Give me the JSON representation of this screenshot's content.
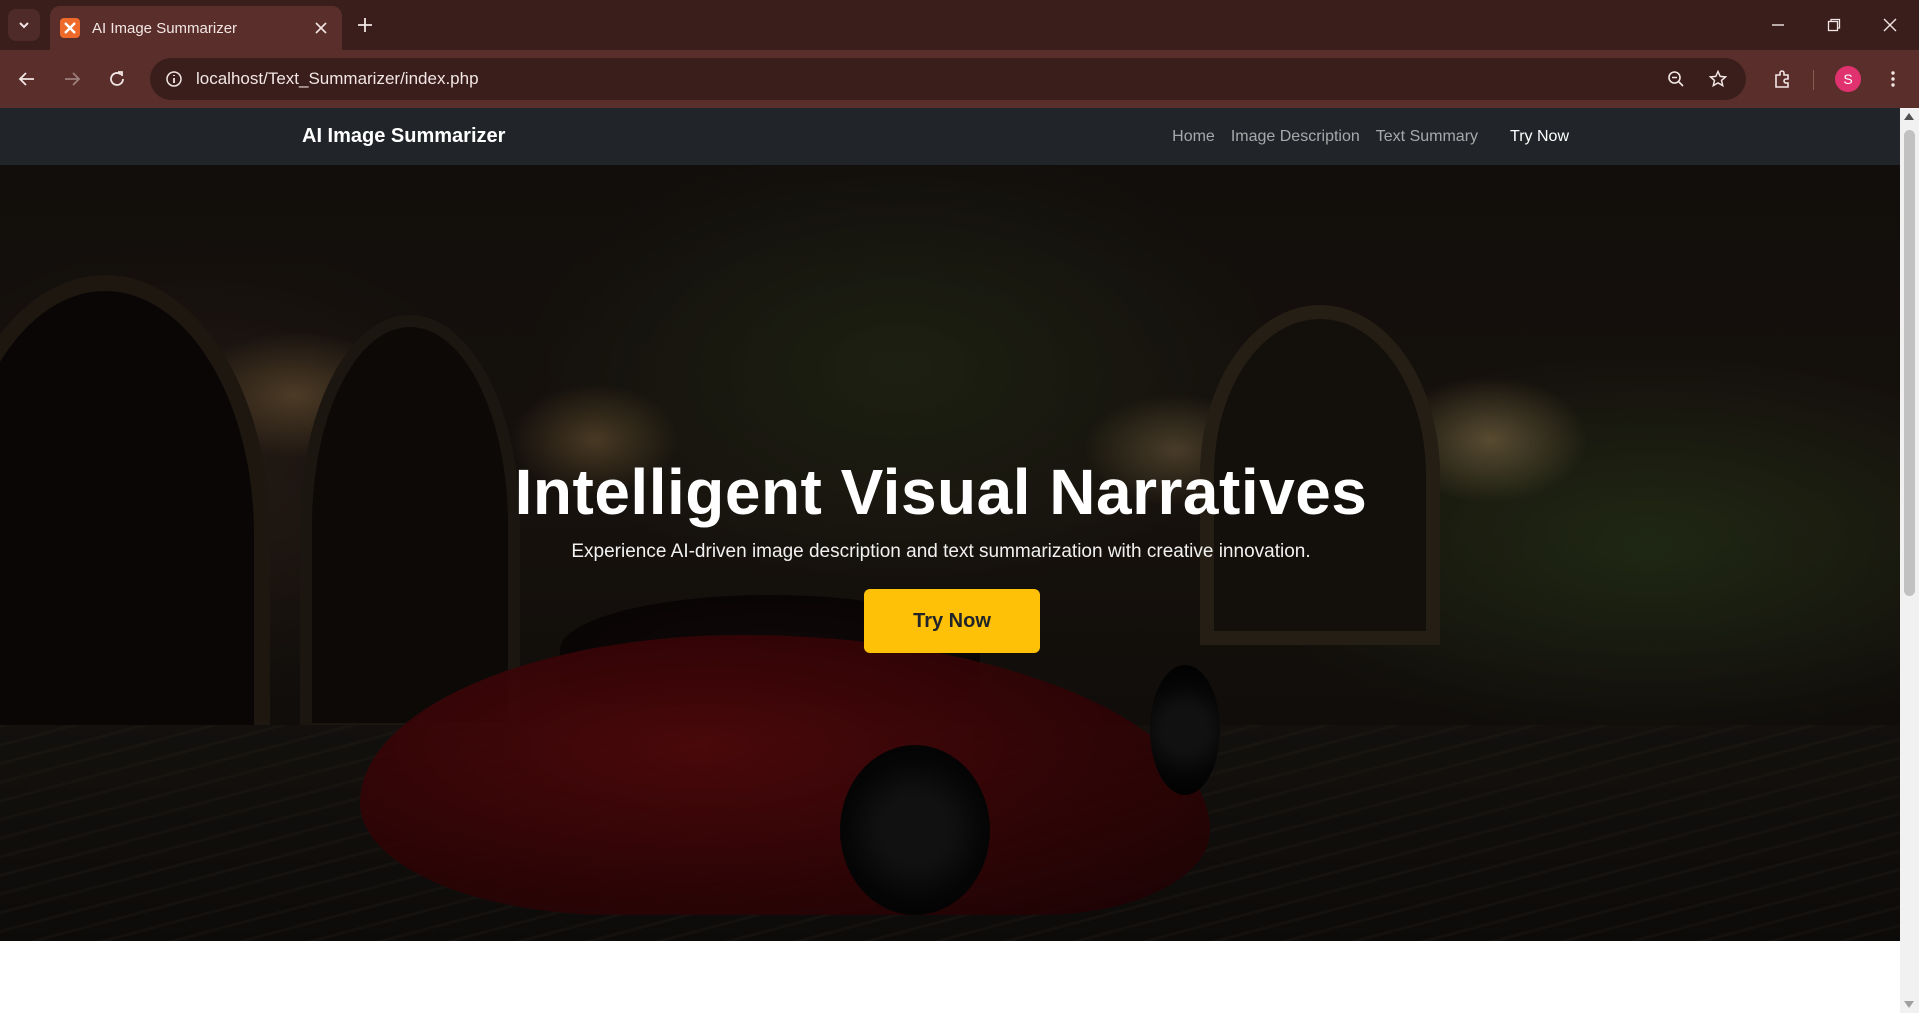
{
  "browser": {
    "tab_title": "AI Image Summarizer",
    "url": "localhost/Text_Summarizer/index.php",
    "profile_initial": "S"
  },
  "site": {
    "brand": "AI Image Summarizer",
    "nav": [
      "Home",
      "Image Description",
      "Text Summary"
    ],
    "nav_cta": "Try Now"
  },
  "hero": {
    "title": "Intelligent Visual Narratives",
    "subtitle": "Experience AI-driven image description and text summarization with creative innovation.",
    "button": "Try Now",
    "background_image": "red sports car parked at night in front of a lit estate with arches and palm trees"
  },
  "colors": {
    "navbar_bg": "#212529",
    "accent_button": "#ffc107",
    "chrome_dark": "#3a1e1c",
    "chrome_toolbar": "#5a2f2b"
  }
}
